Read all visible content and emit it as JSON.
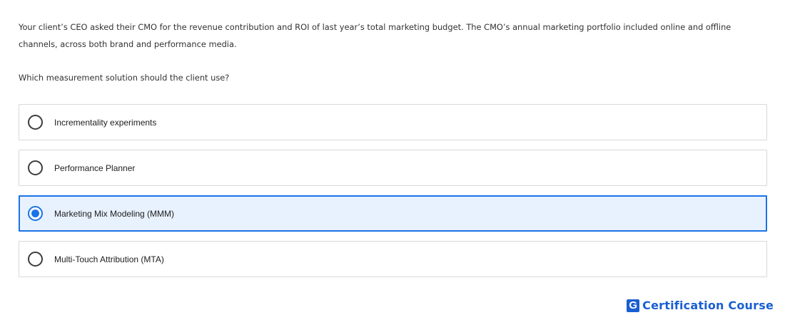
{
  "question": {
    "text": "Your client’s CEO asked their CMO for the revenue contribution and ROI of last year’s total marketing budget. The CMO’s annual marketing portfolio included online and offline channels, across both brand and performance media.",
    "prompt": "Which measurement solution should the client use?"
  },
  "options": [
    {
      "label": "Incrementality experiments",
      "selected": false
    },
    {
      "label": "Performance Planner",
      "selected": false
    },
    {
      "label": "Marketing Mix Modeling (MMM)",
      "selected": true
    },
    {
      "label": "Multi-Touch Attribution (MTA)",
      "selected": false
    }
  ],
  "brand": {
    "logo_letter": "G",
    "name": "Certification Course"
  },
  "colors": {
    "accent": "#1a73e8",
    "selected_bg": "#e8f1fe",
    "brand": "#1a5fd1"
  }
}
